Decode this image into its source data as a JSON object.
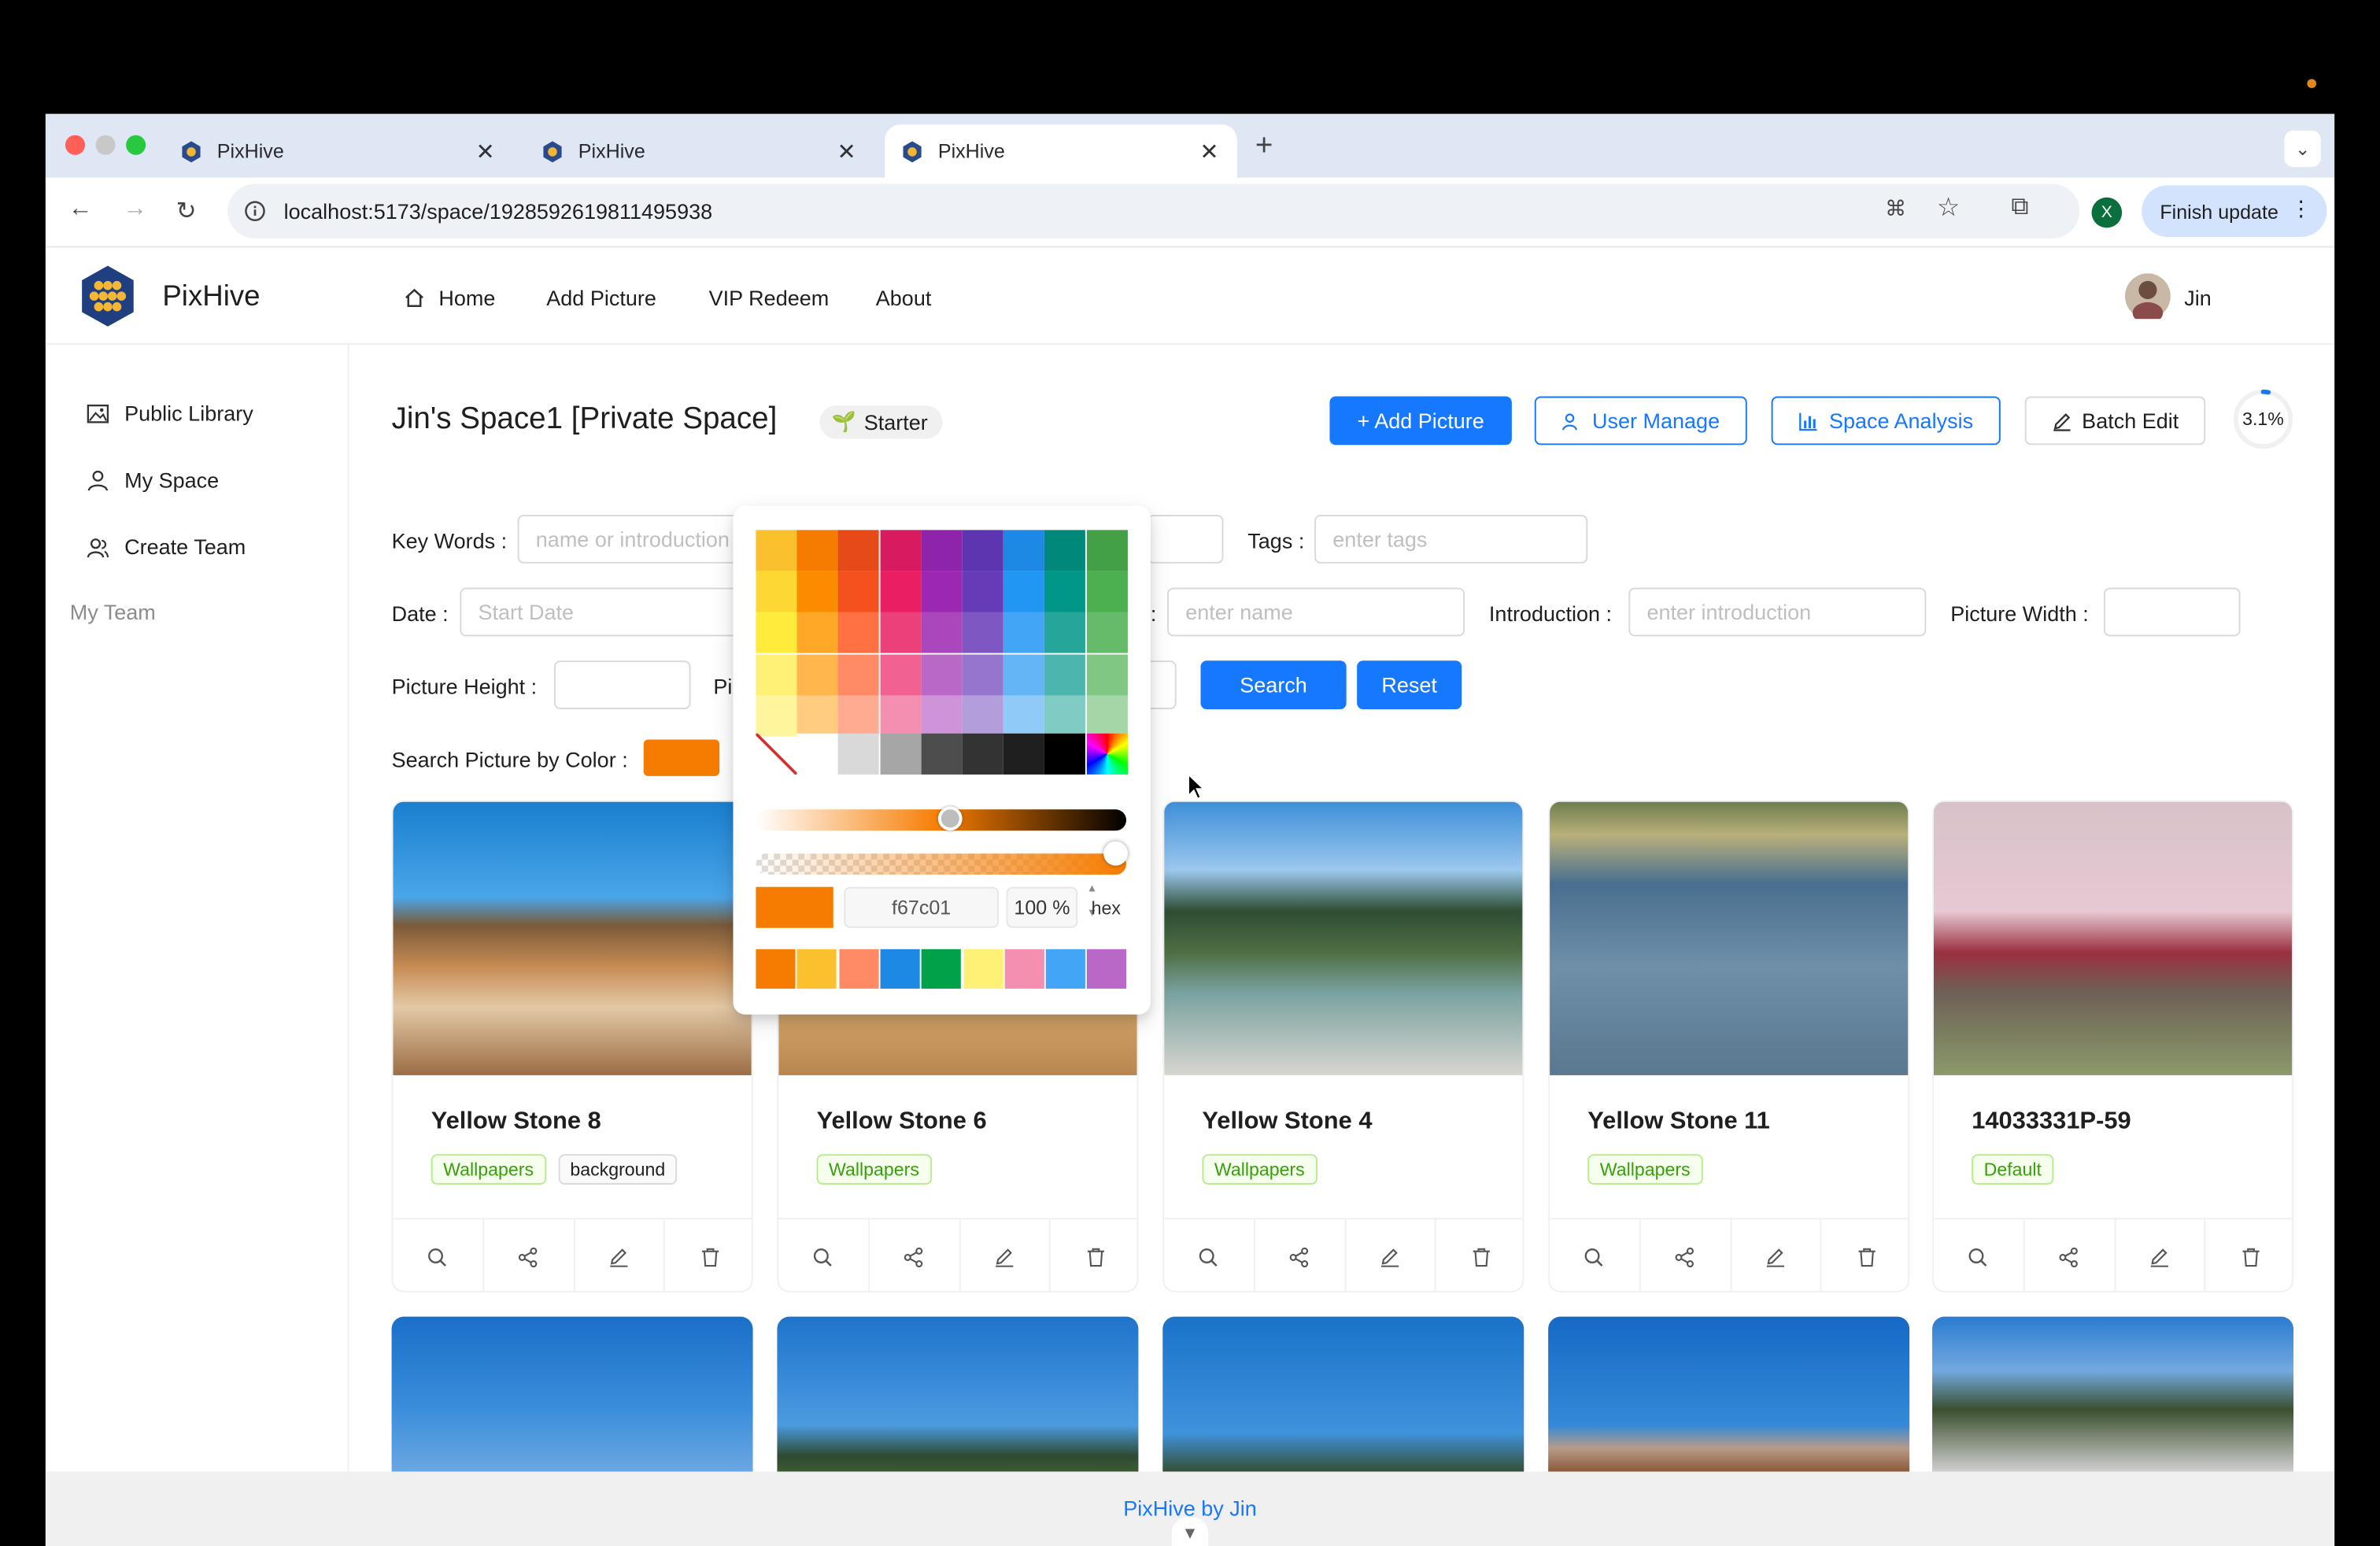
{
  "browser": {
    "tabs": [
      {
        "title": "PixHive"
      },
      {
        "title": "PixHive"
      },
      {
        "title": "PixHive"
      }
    ],
    "url": "localhost:5173/space/1928592619811495938",
    "profile_initial": "X",
    "finish_update": "Finish update"
  },
  "header": {
    "brand": "PixHive",
    "nav": [
      "Home",
      "Add Picture",
      "VIP Redeem",
      "About"
    ],
    "user": "Jin"
  },
  "sidebar": {
    "items": [
      "Public Library",
      "My Space",
      "Create Team"
    ],
    "section": "My Team"
  },
  "space": {
    "title": "Jin's Space1 [Private Space]",
    "level": "Starter",
    "buttons": {
      "add_picture": "+ Add Picture",
      "user_manage": "User Manage",
      "space_analysis": "Space Analysis",
      "batch_edit": "Batch Edit"
    },
    "usage": "3.1%",
    "usage_fraction": 0.031
  },
  "search": {
    "keywords_label": "Key Words",
    "keywords_placeholder": "name or introduction",
    "tags_label": "Tags",
    "tags_placeholder": "enter tags",
    "date_label": "Date",
    "start_date_placeholder": "Start Date",
    "name_placeholder": "enter name",
    "introduction_label": "Introduction",
    "introduction_placeholder": "enter introduction",
    "width_label": "Picture Width",
    "height_label": "Picture Height",
    "format_label_partial": "Pi",
    "search_button": "Search",
    "reset_button": "Reset",
    "color_label": "Search Picture by Color",
    "selected_color": "#f67c01"
  },
  "picker": {
    "hex_value": "f67c01",
    "alpha": "100 %",
    "mode": "hex",
    "presets": [
      "#f67c01",
      "#fbc02d",
      "#ff8a65",
      "#1e88e5",
      "#00a148",
      "#fff176",
      "#f48fb1",
      "#42a5f5",
      "#ba68c8"
    ]
  },
  "pictures": [
    {
      "name": "Yellow Stone 8",
      "tags": [
        "Wallpapers",
        "background"
      ]
    },
    {
      "name": "Yellow Stone 6",
      "tags": [
        "Wallpapers"
      ]
    },
    {
      "name": "Yellow Stone 4",
      "tags": [
        "Wallpapers"
      ]
    },
    {
      "name": "Yellow Stone 11",
      "tags": [
        "Wallpapers"
      ]
    },
    {
      "name": "14033331P-59",
      "tags": [
        "Default"
      ]
    }
  ],
  "footer": "PixHive by Jin"
}
